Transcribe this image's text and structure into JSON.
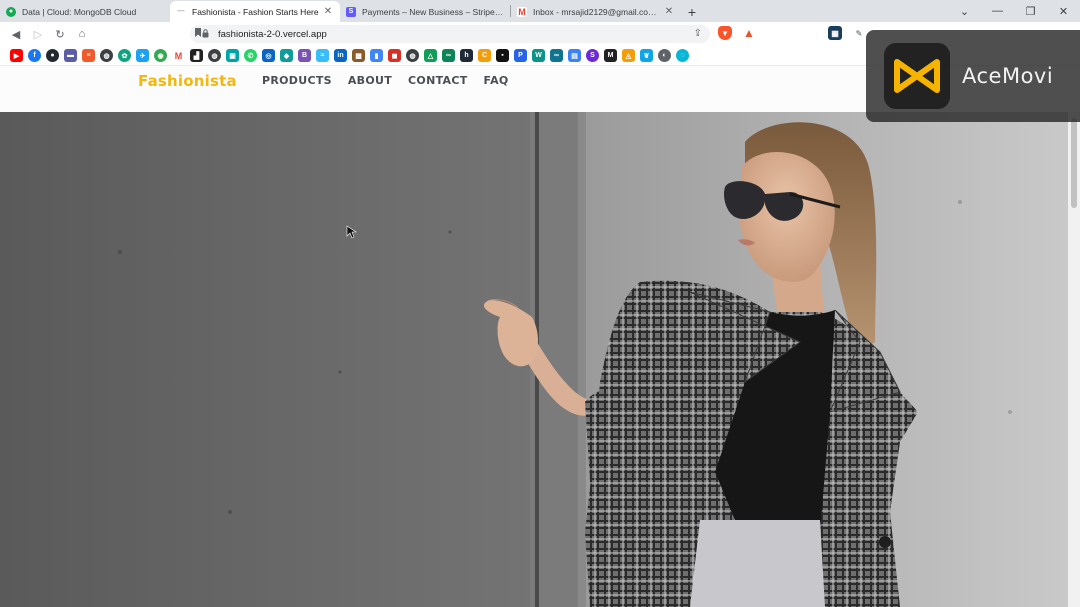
{
  "browser": {
    "tabs": [
      {
        "title": "Data | Cloud: MongoDB Cloud",
        "favicon_color": "#13aa52",
        "active": false
      },
      {
        "title": "Fashionista - Fashion Starts Here",
        "favicon_color": "#9aa0a6",
        "active": true
      },
      {
        "title": "Payments – New Business – Stripe [Te...",
        "favicon_color": "#635bff",
        "active": false
      },
      {
        "title": "Inbox - mrsajid2129@gmail.com - Gm...",
        "favicon_color": "#ea4335",
        "active": false
      }
    ],
    "new_tab_label": "+",
    "url": "fashionista-2-0.vercel.app",
    "window_controls": [
      "chevron-down-icon",
      "minimize-icon",
      "restore-icon",
      "close-icon"
    ]
  },
  "site": {
    "logo": "Fashionista",
    "nav": [
      "PRODUCTS",
      "ABOUT",
      "CONTACT",
      "FAQ"
    ],
    "brand_color": "#f2b80f"
  },
  "watermark": {
    "text": "AceMovi"
  }
}
